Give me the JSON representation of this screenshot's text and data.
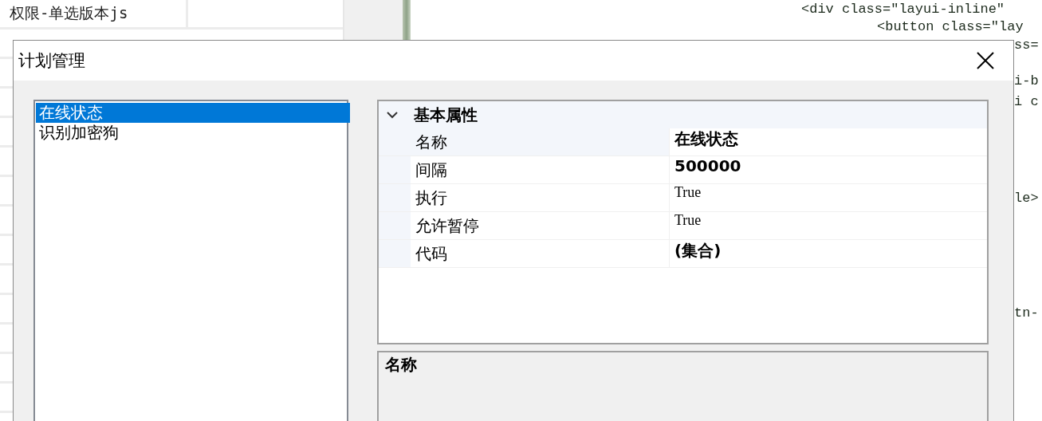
{
  "sheet": {
    "rows": [
      {
        "cells": [
          "权限-单选版本js"
        ]
      }
    ]
  },
  "code_editor": {
    "lines": [
      {
        "text": "<div class=\"layui-inline\""
      },
      {
        "text": "<button class=\"lay"
      },
      {
        "text": "ss="
      },
      {
        "text": "i-b"
      },
      {
        "text": "i c"
      },
      {
        "text": "le>"
      },
      {
        "text": "tn-"
      }
    ]
  },
  "dialog": {
    "title": "计划管理",
    "plans": [
      {
        "label": "在线状态",
        "selected": true
      },
      {
        "label": "识别加密狗",
        "selected": false
      }
    ],
    "property_grid": {
      "category": {
        "label": "基本属性",
        "expanded": true
      },
      "rows": [
        {
          "name": "名称",
          "value": "在线状态",
          "modified": true,
          "selected": true
        },
        {
          "name": "间隔",
          "value": "500000",
          "modified": true,
          "selected": false
        },
        {
          "name": "执行",
          "value": "True",
          "modified": false,
          "selected": false
        },
        {
          "name": "允许暂停",
          "value": "True",
          "modified": false,
          "selected": false
        },
        {
          "name": "代码",
          "value": "(集合)",
          "modified": true,
          "selected": false
        }
      ]
    },
    "description": {
      "title": "名称"
    }
  }
}
